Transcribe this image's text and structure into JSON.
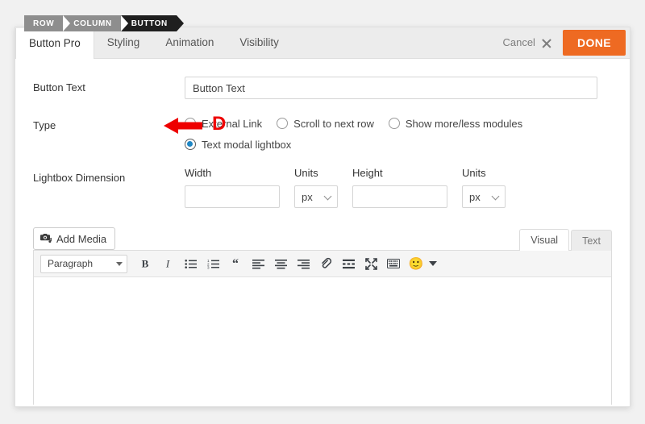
{
  "breadcrumb": {
    "items": [
      {
        "label": "ROW"
      },
      {
        "label": "COLUMN"
      },
      {
        "label": "BUTTON"
      }
    ]
  },
  "panel": {
    "tabs": [
      {
        "label": "Button Pro",
        "active": true
      },
      {
        "label": "Styling",
        "active": false
      },
      {
        "label": "Animation",
        "active": false
      },
      {
        "label": "Visibility",
        "active": false
      }
    ],
    "cancel_label": "Cancel",
    "cancel_icon": "close-icon",
    "done_label": "DONE",
    "done_color": "#ee6a22"
  },
  "form": {
    "button_text": {
      "label": "Button Text",
      "value": "Button Text",
      "placeholder": ""
    },
    "type": {
      "label": "Type",
      "options": [
        {
          "label": "External Link",
          "checked": false
        },
        {
          "label": "Scroll to next row",
          "checked": false
        },
        {
          "label": "Show more/less modules",
          "checked": false
        },
        {
          "label": "Text modal lightbox",
          "checked": true
        }
      ],
      "selected_color": "#1f86c4"
    },
    "lightbox_dimension": {
      "label": "Lightbox Dimension",
      "width_label": "Width",
      "width_value": "",
      "width_units_label": "Units",
      "width_units_value": "px",
      "height_label": "Height",
      "height_value": "",
      "height_units_label": "Units",
      "height_units_value": "px"
    }
  },
  "annotation": {
    "letter": "D",
    "color": "#ee0000",
    "arrow_icon": "left-arrow-icon"
  },
  "editor": {
    "add_media_label": "Add Media",
    "add_media_icon": "media-camera-icon",
    "tabs": [
      {
        "label": "Visual",
        "active": true
      },
      {
        "label": "Text",
        "active": false
      }
    ],
    "toolbar": {
      "format_select_value": "Paragraph",
      "buttons": [
        {
          "icon": "bold-icon",
          "glyph": "B"
        },
        {
          "icon": "italic-icon",
          "glyph": "I"
        },
        {
          "icon": "bulleted-list-icon",
          "glyph": ""
        },
        {
          "icon": "numbered-list-icon",
          "glyph": ""
        },
        {
          "icon": "blockquote-icon",
          "glyph": "“"
        },
        {
          "icon": "align-left-icon",
          "glyph": ""
        },
        {
          "icon": "align-center-icon",
          "glyph": ""
        },
        {
          "icon": "align-right-icon",
          "glyph": ""
        },
        {
          "icon": "link-icon",
          "glyph": ""
        },
        {
          "icon": "read-more-icon",
          "glyph": ""
        },
        {
          "icon": "fullscreen-icon",
          "glyph": ""
        },
        {
          "icon": "toolbar-toggle-icon",
          "glyph": ""
        },
        {
          "icon": "emoji-icon",
          "glyph": "🙂"
        }
      ]
    },
    "content": ""
  }
}
